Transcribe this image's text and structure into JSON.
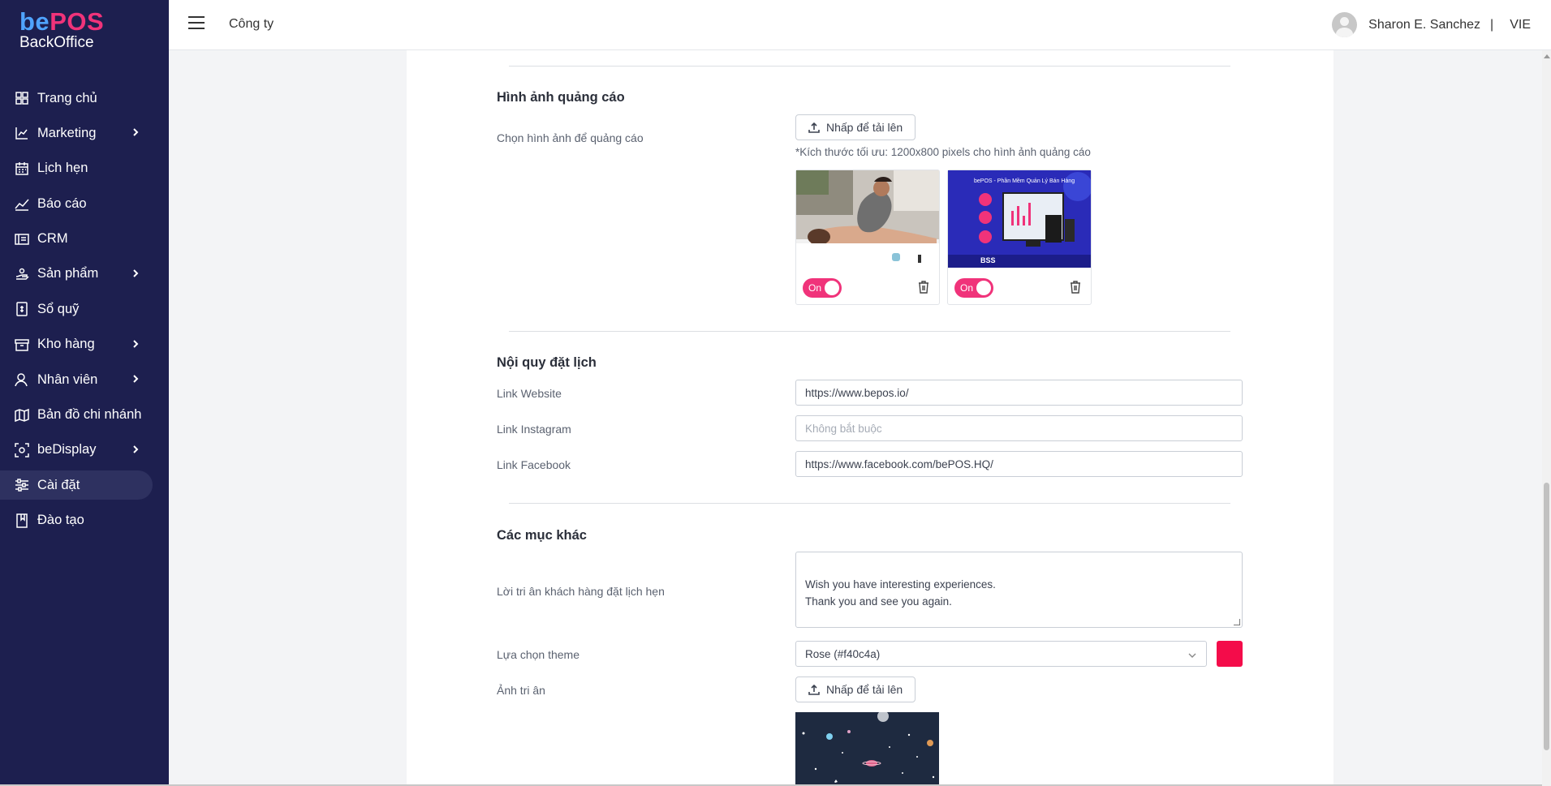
{
  "app": {
    "logo_be": "be",
    "logo_pos": "POS",
    "logo_sub": "BackOffice"
  },
  "sidebar": {
    "items": [
      {
        "label": "Trang chủ",
        "icon": "grid-icon",
        "has_children": false
      },
      {
        "label": "Marketing",
        "icon": "chart-icon",
        "has_children": true
      },
      {
        "label": "Lịch hẹn",
        "icon": "calendar-icon",
        "has_children": false
      },
      {
        "label": "Báo cáo",
        "icon": "trend-icon",
        "has_children": false
      },
      {
        "label": "CRM",
        "icon": "crm-icon",
        "has_children": false
      },
      {
        "label": "Sản phẩm",
        "icon": "product-icon",
        "has_children": true
      },
      {
        "label": "Sổ quỹ",
        "icon": "cashbook-icon",
        "has_children": false
      },
      {
        "label": "Kho hàng",
        "icon": "warehouse-icon",
        "has_children": true
      },
      {
        "label": "Nhân viên",
        "icon": "staff-icon",
        "has_children": true
      },
      {
        "label": "Bản đồ chi nhánh",
        "icon": "map-icon",
        "has_children": false
      },
      {
        "label": "beDisplay",
        "icon": "display-icon",
        "has_children": true
      },
      {
        "label": "Cài đặt",
        "icon": "settings-icon",
        "has_children": false,
        "active": true
      },
      {
        "label": "Đào tạo",
        "icon": "book-icon",
        "has_children": false
      }
    ]
  },
  "header": {
    "breadcrumb": "Công ty",
    "user_name": "Sharon E. Sanchez",
    "separator": "|",
    "language": "VIE"
  },
  "ads": {
    "title": "Hình ảnh quảng cáo",
    "choose_label": "Chọn hình ảnh để quảng cáo",
    "upload_label": "Nhấp để tải lên",
    "hint": "*Kích thước tối ưu: 1200x800 pixels cho hình ảnh quảng cáo",
    "images": [
      {
        "toggle_label": "On",
        "enabled": true
      },
      {
        "toggle_label": "On",
        "enabled": true,
        "caption": "bePOS - Phần Mềm Quản Lý Bán Hàng",
        "brand": "BSS"
      }
    ]
  },
  "booking": {
    "title": "Nội quy đặt lịch",
    "website_label": "Link Website",
    "website_value": "https://www.bepos.io/",
    "instagram_label": "Link Instagram",
    "instagram_placeholder": "Không bắt buộc",
    "facebook_label": "Link Facebook",
    "facebook_value": "https://www.facebook.com/bePOS.HQ/"
  },
  "other": {
    "title": "Các mục khác",
    "thanks_label": "Lời tri ân khách hàng đặt lịch hẹn",
    "thanks_value": "Wish you have interesting experiences.\nThank you and see you again.",
    "theme_label": "Lựa chọn theme",
    "theme_value": "Rose (#f40c4a)",
    "theme_color": "#f40c4a",
    "thank_image_label": "Ảnh tri ân",
    "upload_label": "Nhấp để tải lên"
  },
  "colors": {
    "sidebar_bg": "#1d1f4f",
    "accent": "#f0337a",
    "logo_blue": "#4fa3ff"
  }
}
